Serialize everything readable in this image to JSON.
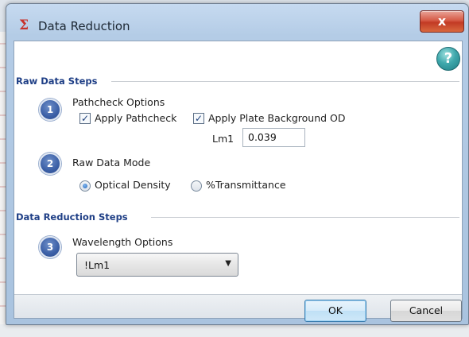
{
  "window": {
    "title": "Data Reduction",
    "title_icon": "sigma-icon",
    "close_label": "x",
    "help_label": "?"
  },
  "raw_data_section": {
    "heading": "Raw Data Steps",
    "step1": {
      "number": "1",
      "title": "Pathcheck Options",
      "apply_pathcheck": {
        "label": "Apply Pathcheck",
        "checked": true
      },
      "apply_plate_bg": {
        "label": "Apply Plate Background OD",
        "checked": true
      },
      "lm1_label": "Lm1",
      "lm1_value": "0.039"
    },
    "step2": {
      "number": "2",
      "title": "Raw Data Mode",
      "options": [
        {
          "label": "Optical Density",
          "selected": true
        },
        {
          "label": "%Transmittance",
          "selected": false
        }
      ]
    }
  },
  "data_reduction_section": {
    "heading": "Data Reduction Steps",
    "step3": {
      "number": "3",
      "title": "Wavelength Options",
      "selected_value": "!Lm1"
    }
  },
  "footer": {
    "ok_label": "OK",
    "cancel_label": "Cancel"
  },
  "colors": {
    "section_heading": "#1f3f86",
    "step_circle": "#3b5fa6",
    "close_button": "#c23a24"
  }
}
